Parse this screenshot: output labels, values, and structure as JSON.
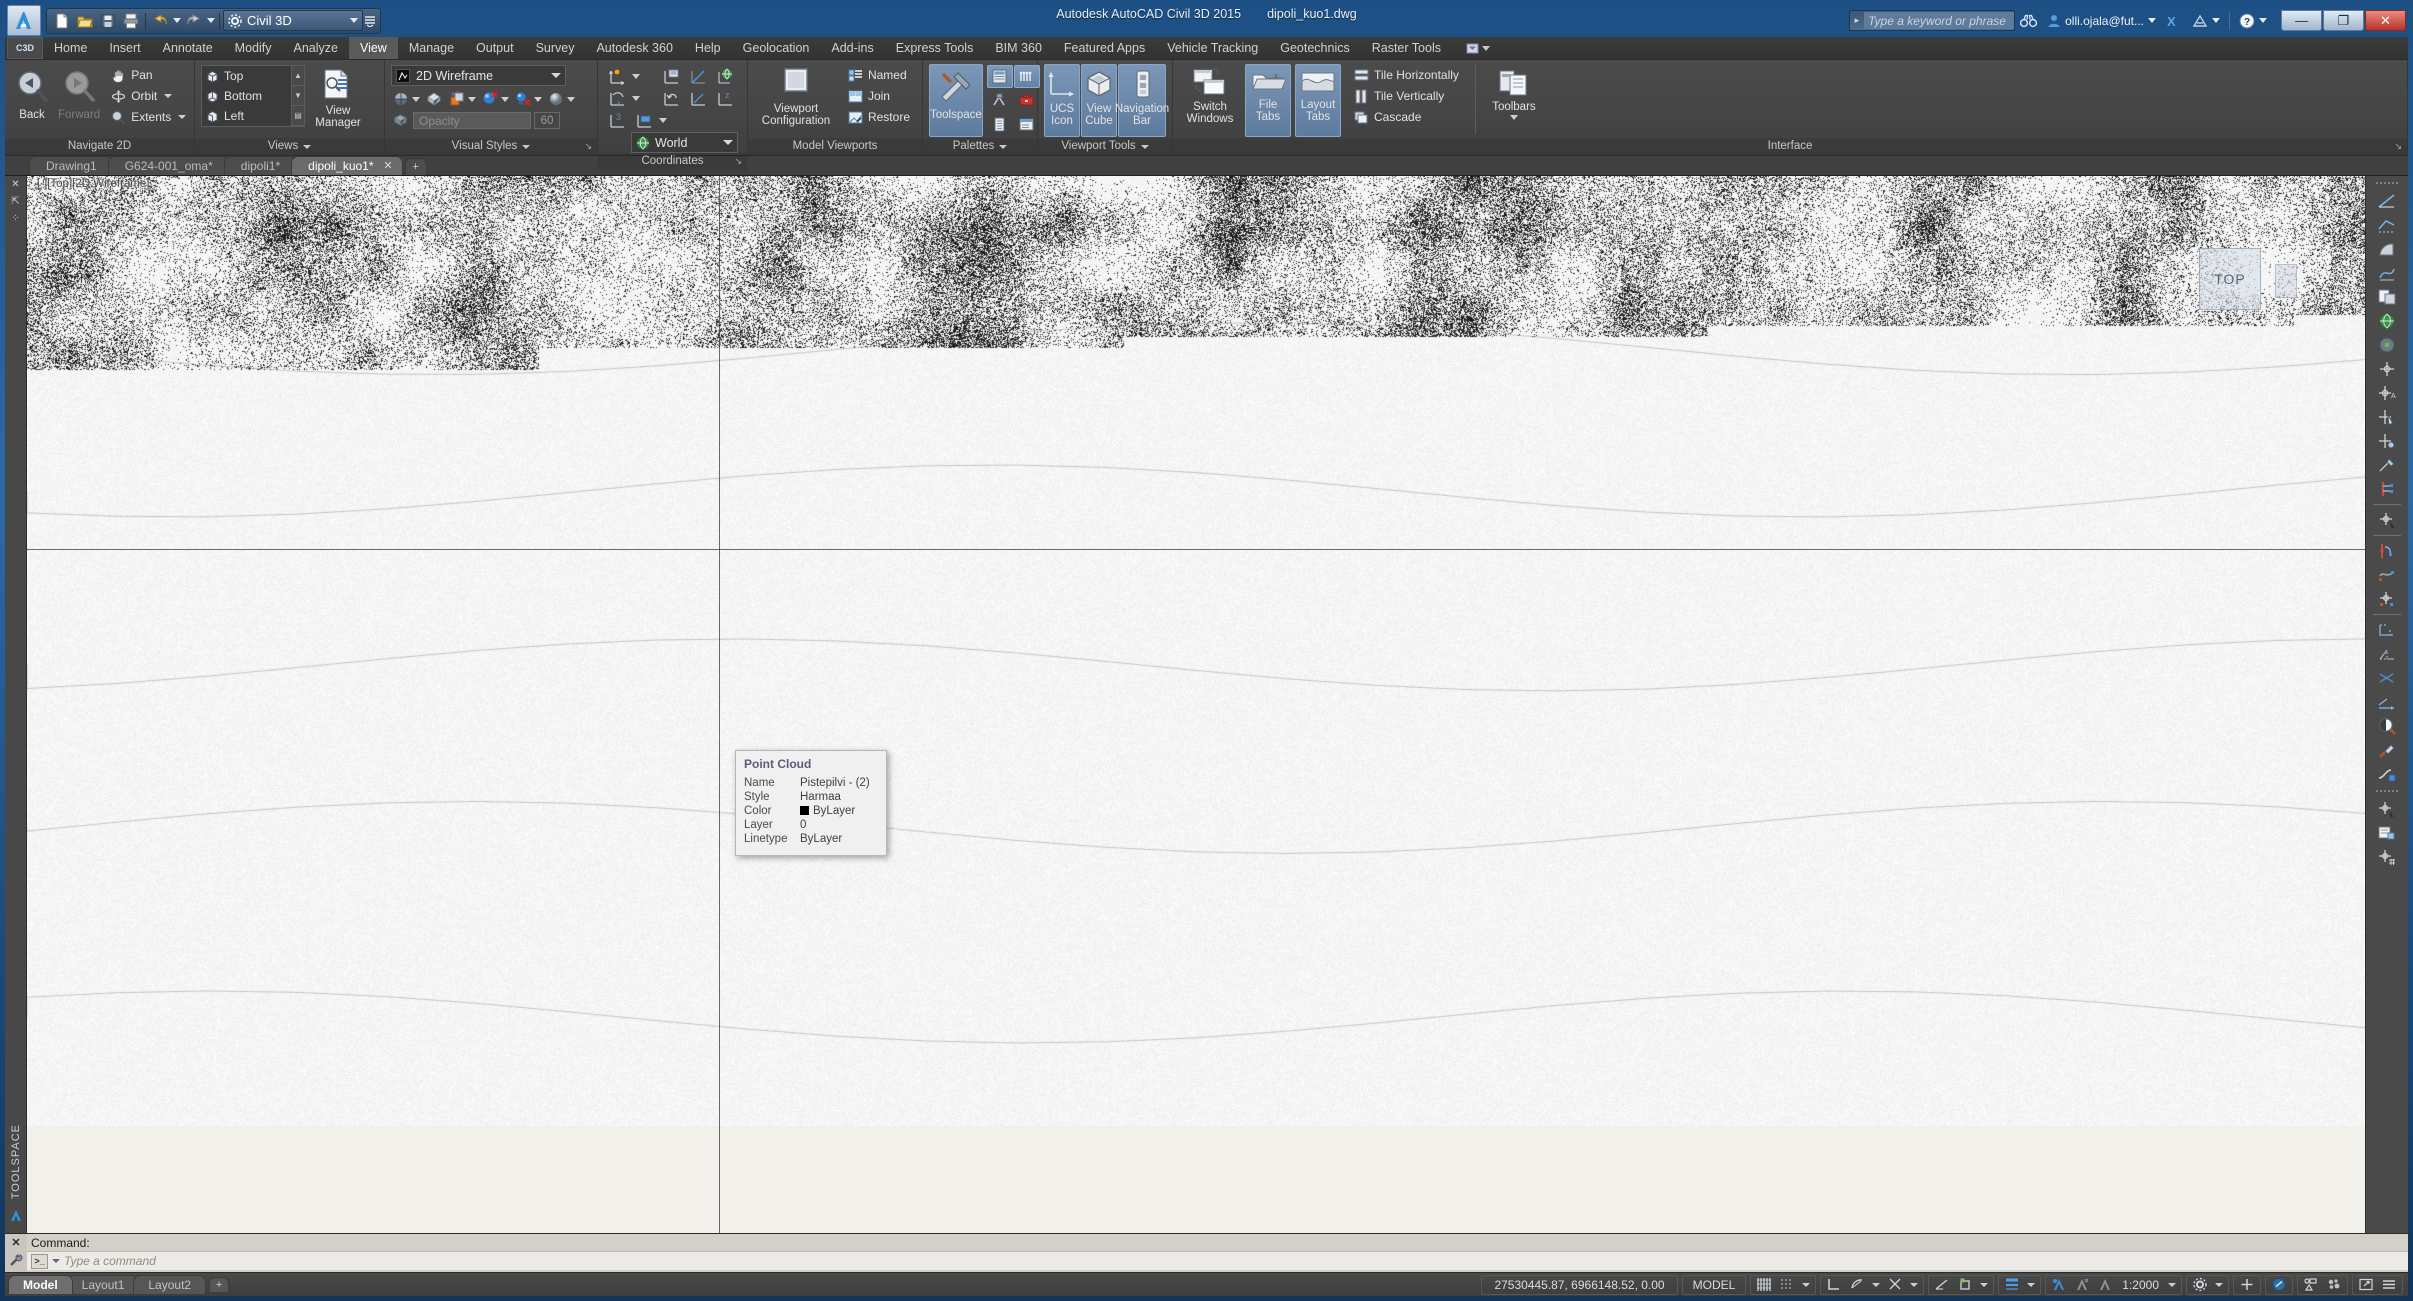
{
  "window": {
    "title": "Autodesk AutoCAD Civil 3D 2015",
    "document": "dipoli_kuo1.dwg",
    "minimize_label": "—",
    "maximize_label": "❐",
    "close_label": "✕"
  },
  "quick_access": {
    "workspace": "Civil 3D",
    "items": [
      {
        "name": "new-icon",
        "label": "New"
      },
      {
        "name": "open-icon",
        "label": "Open"
      },
      {
        "name": "save-icon",
        "label": "Save"
      },
      {
        "name": "plot-icon",
        "label": "Plot"
      },
      {
        "name": "undo-icon",
        "label": "Undo"
      },
      {
        "name": "redo-icon",
        "label": "Redo"
      }
    ]
  },
  "infocenter": {
    "placeholder": "Type a keyword or phrase",
    "search_icon": "binoculars-icon",
    "user": "olli.ojala@fut...",
    "exchange_icon": "autodesk-exchange-icon",
    "a360_icon": "a360-icon",
    "help_icon": "help-icon"
  },
  "ribbon": {
    "app_badge": "C3D",
    "tabs": [
      {
        "label": "Home",
        "active": false
      },
      {
        "label": "Insert",
        "active": false
      },
      {
        "label": "Annotate",
        "active": false
      },
      {
        "label": "Modify",
        "active": false
      },
      {
        "label": "Analyze",
        "active": false
      },
      {
        "label": "View",
        "active": true
      },
      {
        "label": "Manage",
        "active": false
      },
      {
        "label": "Output",
        "active": false
      },
      {
        "label": "Survey",
        "active": false
      },
      {
        "label": "Autodesk 360",
        "active": false
      },
      {
        "label": "Help",
        "active": false
      },
      {
        "label": "Geolocation",
        "active": false
      },
      {
        "label": "Add-ins",
        "active": false
      },
      {
        "label": "Express Tools",
        "active": false
      },
      {
        "label": "BIM 360",
        "active": false
      },
      {
        "label": "Featured Apps",
        "active": false
      },
      {
        "label": "Vehicle Tracking",
        "active": false
      },
      {
        "label": "Geotechnics",
        "active": false
      },
      {
        "label": "Raster Tools",
        "active": false
      }
    ],
    "panels": {
      "navigate": {
        "title": "Navigate 2D",
        "back": "Back",
        "forward": "Forward",
        "pan": "Pan",
        "orbit": "Orbit",
        "extents": "Extents"
      },
      "views": {
        "title": "Views",
        "list": [
          "Top",
          "Bottom",
          "Left"
        ],
        "view_manager": "View\nManager",
        "view_manager_l1": "View",
        "view_manager_l2": "Manager"
      },
      "visual_styles": {
        "title": "Visual Styles",
        "current": "2D Wireframe",
        "opacity_placeholder": "Opacity",
        "opacity_value": "60"
      },
      "coordinates": {
        "title": "Coordinates",
        "ucs_current": "World"
      },
      "model_viewports": {
        "title": "Model Viewports",
        "viewport_config_l1": "Viewport",
        "viewport_config_l2": "Configuration",
        "named": "Named",
        "join": "Join",
        "restore": "Restore"
      },
      "palettes": {
        "title": "Palettes",
        "toolspace": "Toolspace"
      },
      "viewport_tools": {
        "title": "Viewport Tools",
        "ucs_icon_l1": "UCS",
        "ucs_icon_l2": "Icon",
        "view_cube_l1": "View",
        "view_cube_l2": "Cube",
        "nav_bar_l1": "Navigation",
        "nav_bar_l2": "Bar"
      },
      "interface": {
        "title": "Interface",
        "switch_windows_l1": "Switch",
        "switch_windows_l2": "Windows",
        "file_tabs_l1": "File",
        "file_tabs_l2": "Tabs",
        "layout_tabs_l1": "Layout",
        "layout_tabs_l2": "Tabs",
        "tile_horizontally": "Tile Horizontally",
        "tile_vertically": "Tile Vertically",
        "cascade": "Cascade",
        "toolbars": "Toolbars"
      }
    }
  },
  "file_tabs": [
    {
      "label": "Drawing1",
      "active": false
    },
    {
      "label": "G624-001_oma*",
      "active": false
    },
    {
      "label": "dipoli1*",
      "active": false
    },
    {
      "label": "dipoli_kuo1*",
      "active": true
    }
  ],
  "file_tab_add": "+",
  "toolspace": {
    "label": "TOOLSPACE",
    "close_icon": "close-icon",
    "pin_icon": "pin-icon",
    "menu_icon": "panel-menu-icon"
  },
  "viewport": {
    "label": "[-][Top][2D Wireframe]",
    "viewcube_face": "TOP"
  },
  "point_cloud_tooltip": {
    "title": "Point Cloud",
    "rows": [
      {
        "key": "Name",
        "value": "Pistepilvi - (2)"
      },
      {
        "key": "Style",
        "value": "Harmaa"
      },
      {
        "key": "Color",
        "value": "ByLayer",
        "swatch": "#000000"
      },
      {
        "key": "Layer",
        "value": "0"
      },
      {
        "key": "Linetype",
        "value": "ByLayer"
      }
    ]
  },
  "command_line": {
    "history": "Command:",
    "placeholder": "Type a command",
    "close_icon": "close-icon",
    "settings_icon": "wrench-icon"
  },
  "status_bar": {
    "layout_tabs": [
      {
        "label": "Model",
        "active": true
      },
      {
        "label": "Layout1",
        "active": false
      },
      {
        "label": "Layout2",
        "active": false
      }
    ],
    "layout_add": "+",
    "coordinates": "27530445.87, 6966148.52, 0.00",
    "space": "MODEL",
    "scale": "1:2000",
    "toggles": [
      {
        "name": "grid-display-icon"
      },
      {
        "name": "snap-mode-icon"
      },
      {
        "name": "ortho-mode-icon"
      },
      {
        "name": "polar-tracking-icon"
      },
      {
        "name": "object-snap-icon"
      },
      {
        "name": "object-snap-tracking-icon"
      },
      {
        "name": "lineweight-icon"
      },
      {
        "name": "transparency-icon"
      },
      {
        "name": "selection-cycling-icon"
      },
      {
        "name": "annotation-visibility-icon"
      },
      {
        "name": "autoscale-icon"
      },
      {
        "name": "annotation-scale-icon"
      },
      {
        "name": "workspace-switching-icon"
      },
      {
        "name": "hardware-acceleration-icon"
      },
      {
        "name": "isolate-objects-icon"
      },
      {
        "name": "clean-screen-icon"
      },
      {
        "name": "customization-icon"
      }
    ]
  },
  "colors": {
    "accent_blue": "#6f8fb2",
    "ribbon_bg": "#454545",
    "canvas_bg": "#f2f0eb",
    "title_blue": "#2d6aa5"
  }
}
